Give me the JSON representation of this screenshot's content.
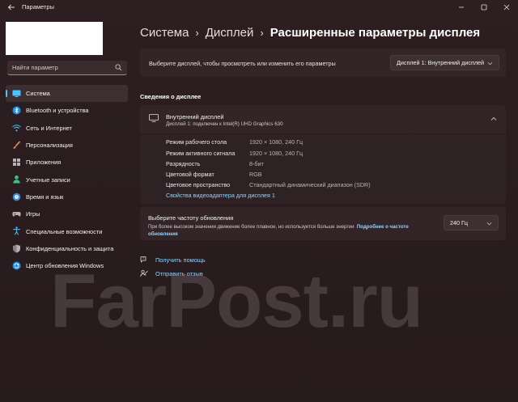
{
  "window": {
    "title": "Параметры",
    "background": "#2d1f21",
    "accent": "#4cc2ff"
  },
  "search": {
    "placeholder": "Найти параметр"
  },
  "sidebar": {
    "items": [
      {
        "label": "Система",
        "icon": "system-icon",
        "active": true
      },
      {
        "label": "Bluetooth и устройства",
        "icon": "bluetooth-icon"
      },
      {
        "label": "Сеть и Интернет",
        "icon": "wifi-icon"
      },
      {
        "label": "Персонализация",
        "icon": "brush-icon"
      },
      {
        "label": "Приложения",
        "icon": "apps-icon"
      },
      {
        "label": "Учетные записи",
        "icon": "person-icon"
      },
      {
        "label": "Время и язык",
        "icon": "globe-icon"
      },
      {
        "label": "Игры",
        "icon": "gamepad-icon"
      },
      {
        "label": "Специальные возможности",
        "icon": "accessibility-icon"
      },
      {
        "label": "Конфиденциальность и защита",
        "icon": "shield-icon"
      },
      {
        "label": "Центр обновления Windows",
        "icon": "update-icon"
      }
    ]
  },
  "breadcrumb": {
    "part1": "Система",
    "part2": "Дисплей",
    "current": "Расширенные параметры дисплея",
    "separator": "›"
  },
  "display_select": {
    "label": "Выберите дисплей, чтобы просмотреть или изменить его параметры",
    "value": "Дисплей 1: Внутренний дисплей"
  },
  "info_section": {
    "title": "Сведения о дисплее",
    "display_name": "Внутренний дисплей",
    "display_sub": "Дисплей 1: подключен к Intel(R) UHD Graphics 630",
    "properties": [
      {
        "key": "Режим рабочего стола",
        "value": "1920 × 1080, 240 Гц"
      },
      {
        "key": "Режим активного сигнала",
        "value": "1920 × 1080, 240 Гц"
      },
      {
        "key": "Разрядность",
        "value": "8-бит"
      },
      {
        "key": "Цветовой формат",
        "value": "RGB"
      },
      {
        "key": "Цветовое пространство",
        "value": "Стандартный динамический диапазон (SDR)"
      }
    ],
    "adapter_link": "Свойства видеоадаптера для дисплея 1"
  },
  "refresh": {
    "title": "Выберите частоту обновления",
    "desc": "При более высоком значении движение более плавное, но используется больше энергии",
    "link_line1": "Подробнее о частоте",
    "link_line2": "обновления",
    "value": "240 Гц"
  },
  "help": {
    "get_help": "Получить помощь",
    "feedback": "Отправить отзыв"
  },
  "watermark": {
    "text": "FarPost.ru"
  }
}
